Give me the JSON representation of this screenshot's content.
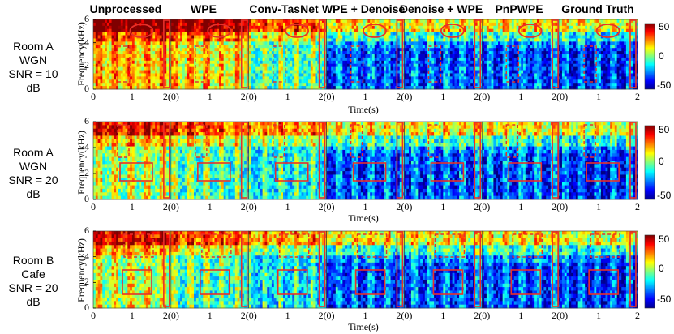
{
  "columns": [
    "Unprocessed",
    "WPE",
    "Conv-TasNet",
    "WPE + Denoise",
    "Denoise + WPE",
    "PnPWPE",
    "Ground Truth"
  ],
  "rows": [
    {
      "room": "Room A",
      "noise": "WGN",
      "snr": "SNR = 10 dB"
    },
    {
      "room": "Room A",
      "noise": "WGN",
      "snr": "SNR = 20 dB"
    },
    {
      "room": "Room B",
      "noise": "Cafe",
      "snr": "SNR = 20 dB"
    }
  ],
  "axes": {
    "ylabel": "Frequency(kHz)",
    "xlabel": "Time(s)",
    "y_ticks": [
      "6",
      "4",
      "2",
      "0"
    ],
    "x_ticks_first": [
      "0",
      "1",
      "2(0)"
    ],
    "x_ticks_middle": [
      "1",
      "2(0)"
    ],
    "x_ticks_last": [
      "1",
      "2"
    ]
  },
  "colorbar": {
    "ticks": [
      "50",
      "0",
      "-50"
    ],
    "colors": [
      "#7f0000",
      "#ff0000",
      "#ff8000",
      "#ffff00",
      "#80ff80",
      "#00ffff",
      "#0080ff",
      "#0000ff",
      "#00008f"
    ]
  },
  "highlight_color": "#e8302a"
}
